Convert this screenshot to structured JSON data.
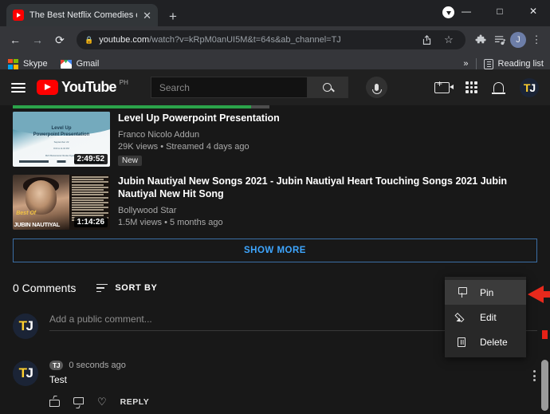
{
  "browser": {
    "tab": {
      "title": "The Best Netflix Comedies of Jun",
      "favicon": "youtube-favicon",
      "close_label": "✕"
    },
    "new_tab_label": "+",
    "window_controls": {
      "minimize": "—",
      "maximize": "□",
      "close": "✕"
    },
    "download_indicator": "download-arrow",
    "nav": {
      "back": "←",
      "forward": "→",
      "reload": "⟳"
    },
    "omnibox": {
      "lock": "🔒",
      "domain": "youtube.com",
      "path": "/watch?v=kRpM0anUI5M&t=64s&ab_channel=TJ",
      "full_url": "youtube.com/watch?v=kRpM0anUI5M&t=64s&ab_channel=TJ",
      "share_icon": "share-icon",
      "bookmark_icon": "star-icon"
    },
    "toolbar": {
      "extensions_icon": "puzzle-icon",
      "media_icon": "playlist-icon",
      "profile_initial": "J",
      "menu_icon": "three-dot-menu-icon"
    },
    "bookmarks": [
      {
        "label": "Skype",
        "icon": "skype-icon"
      },
      {
        "label": "Gmail",
        "icon": "gmail-icon"
      }
    ],
    "bookmarks_overflow": "»",
    "reading_list": {
      "label": "Reading list",
      "icon": "reading-list-icon"
    }
  },
  "youtube": {
    "header": {
      "menu_icon": "hamburger-menu-icon",
      "logo_text": "YouTube",
      "country_code": "PH",
      "search_placeholder": "Search",
      "search_value": "",
      "search_icon": "search-icon",
      "mic_icon": "microphone-icon",
      "create_icon": "create-video-icon",
      "apps_icon": "apps-grid-icon",
      "notifications_icon": "bell-icon",
      "avatar_initials": "TJ",
      "avatar_first": "T",
      "avatar_second": "J"
    },
    "videos": [
      {
        "title": "Level Up Powerpoint Presentation",
        "channel": "Franco Nicolo Addun",
        "stats": "29K views • Streamed 4 days ago",
        "badge": "New",
        "duration": "2:49:52",
        "thumb_line1": "Level Up",
        "thumb_line2": "Powerpoint Presentation",
        "thumb_line3": "September 22",
        "thumb_line4": "8:00 to 11:00 PM",
        "thumb_line5": "Mich Bustamante Nicolas Figueroa",
        "thumb_line6": "& a word with 7 days",
        "watch_progress": 93
      },
      {
        "title": "Jubin Nautiyal New Songs 2021 - Jubin Nautiyal Heart Touching Songs 2021 Jubin Nautiyal New Hit Song",
        "channel": "Bollywood Star",
        "stats": "1.5M views • 5 months ago",
        "badge": "",
        "duration": "1:14:26",
        "thumb_best": "Best Of",
        "thumb_name": "JUBIN NAUTIYAL"
      }
    ],
    "show_more_label": "SHOW MORE",
    "comments": {
      "count_label": "0 Comments",
      "sort_label": "SORT BY",
      "sort_icon": "sort-icon",
      "add_placeholder": "Add a public comment...",
      "avatar_first": "T",
      "avatar_second": "J",
      "items": [
        {
          "author_chip": "TJ",
          "time": "0 seconds ago",
          "text": "Test",
          "like_icon": "thumbs-up-icon",
          "dislike_icon": "thumbs-down-icon",
          "heart_icon": "heart-icon",
          "reply_label": "REPLY",
          "kebab_icon": "more-options-icon"
        }
      ]
    }
  },
  "context_menu": {
    "items": [
      {
        "label": "Pin",
        "icon": "pin-icon",
        "highlighted": true
      },
      {
        "label": "Edit",
        "icon": "pencil-icon",
        "highlighted": false
      },
      {
        "label": "Delete",
        "icon": "trash-icon",
        "highlighted": false
      }
    ],
    "annotation_arrow": "red-arrow-pointing-left",
    "arrow_color": "#e8291c"
  }
}
